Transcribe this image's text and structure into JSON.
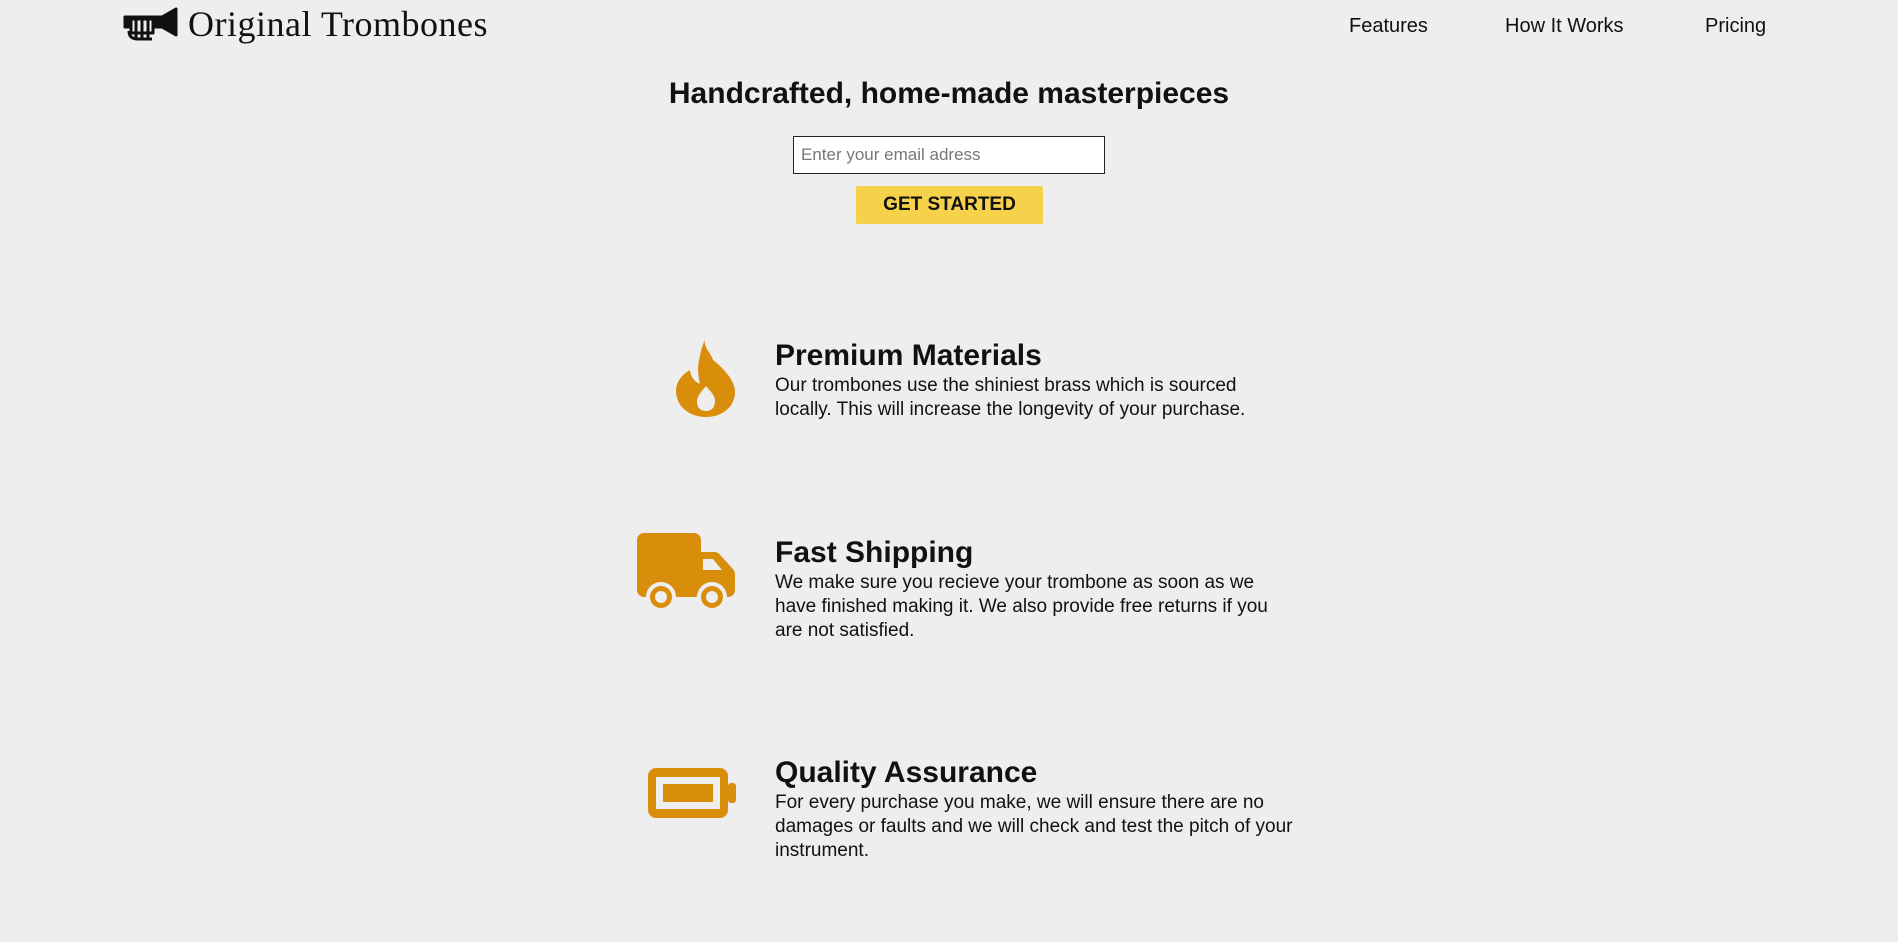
{
  "brand": {
    "name": "Original Trombones",
    "icon": "trombone-logo-icon"
  },
  "nav": {
    "items": [
      {
        "label": "Features"
      },
      {
        "label": "How It Works"
      },
      {
        "label": "Pricing"
      }
    ]
  },
  "hero": {
    "title": "Handcrafted, home-made masterpieces",
    "email_placeholder": "Enter your email adress",
    "email_value": "",
    "cta_label": "GET STARTED"
  },
  "features": [
    {
      "icon": "fire-icon",
      "title": "Premium Materials",
      "description": "Our trombones use the shiniest brass which is sourced locally. This will increase the longevity of your purchase."
    },
    {
      "icon": "truck-icon",
      "title": "Fast Shipping",
      "description": "We make sure you recieve your trombone as soon as we have finished making it. We also provide free returns if you are not satisfied."
    },
    {
      "icon": "battery-icon",
      "title": "Quality Assurance",
      "description": "For every purchase you make, we will ensure there are no damages or faults and we will check and test the pitch of your instrument."
    }
  ],
  "colors": {
    "background": "#eeeeee",
    "accent": "#d98e0b",
    "cta": "#f5d24a",
    "text": "#111111"
  }
}
